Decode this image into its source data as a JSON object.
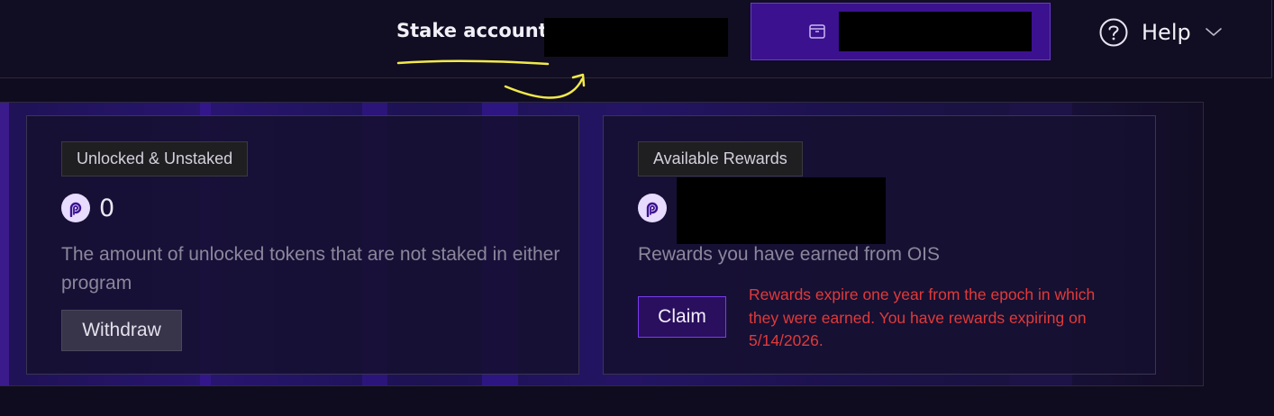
{
  "header": {
    "stake_account_label": "Stake account:",
    "help_label": "Help",
    "accent_color": "#3b118f"
  },
  "cards": {
    "unlocked": {
      "badge": "Unlocked & Unstaked",
      "amount": "0",
      "description": "The amount of unlocked tokens that are not staked in either program",
      "button": "Withdraw"
    },
    "rewards": {
      "badge": "Available Rewards",
      "description": "Rewards you have earned from OIS",
      "button": "Claim",
      "warning": "Rewards expire one year from the epoch in which they were earned. You have rewards expiring on 5/14/2026.",
      "warning_color": "#e03a3a"
    }
  },
  "icons": {
    "wallet": "wallet-icon",
    "help": "question-circle-icon",
    "chevron": "chevron-down-icon",
    "token": "pyth-token-icon"
  }
}
